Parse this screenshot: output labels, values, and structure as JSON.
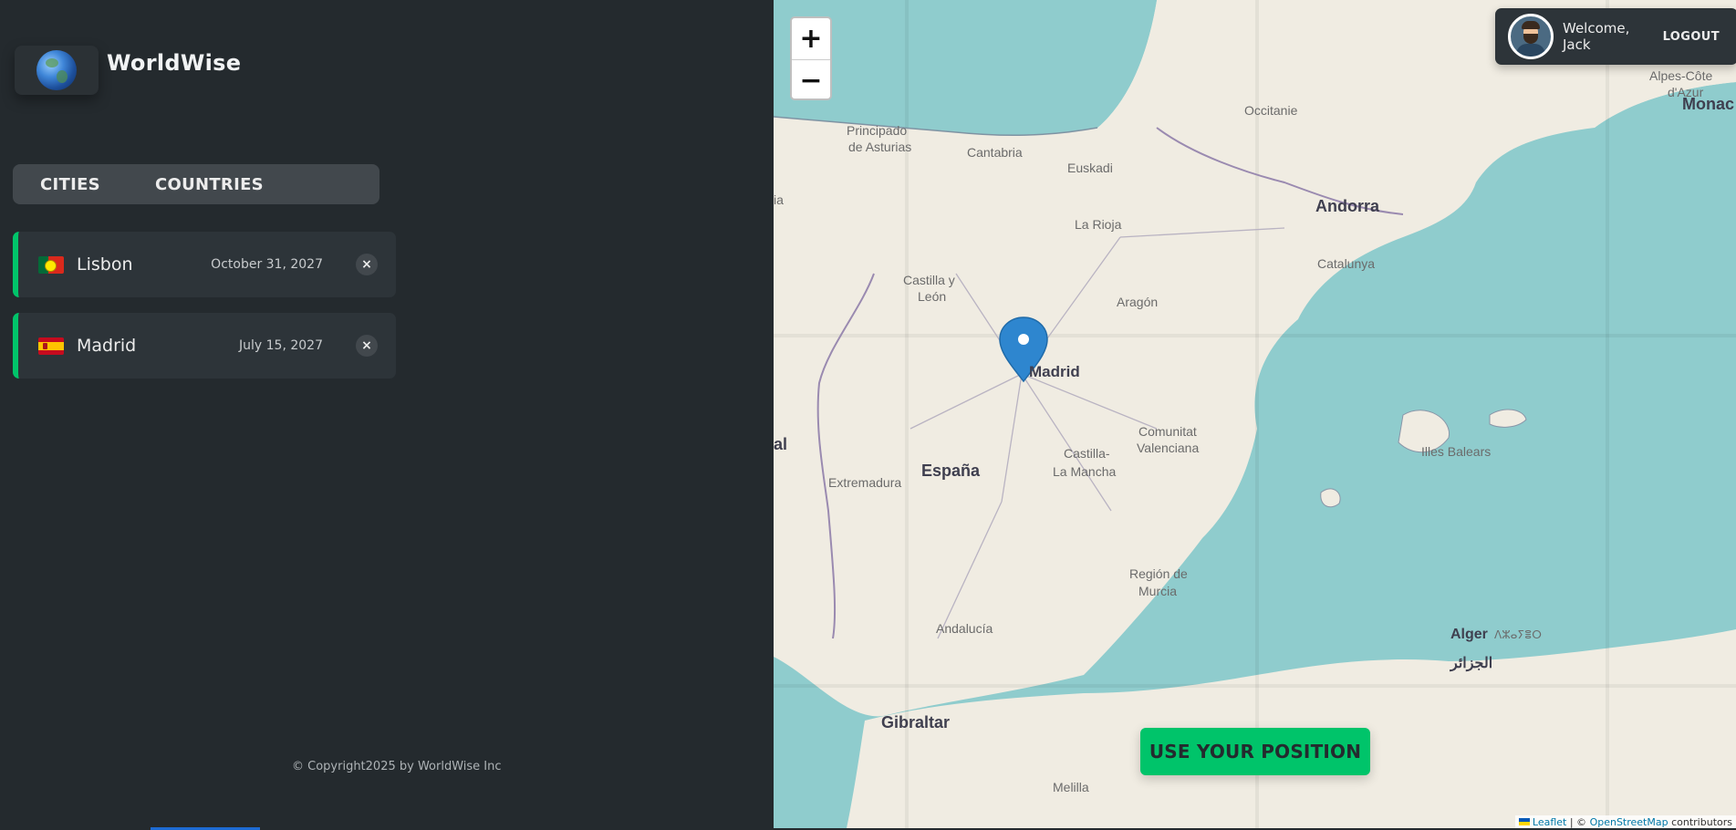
{
  "app": {
    "name": "WorldWise"
  },
  "tabs": [
    {
      "label": "CITIES"
    },
    {
      "label": "COUNTRIES"
    }
  ],
  "cities": [
    {
      "name": "Lisbon",
      "date": "October 31, 2027",
      "delete": "×",
      "flag": "portugal-flag-icon"
    },
    {
      "name": "Madrid",
      "date": "July 15, 2027",
      "delete": "×",
      "flag": "spain-flag-icon"
    }
  ],
  "footer": {
    "copyright": "© Copyright2025 by WorldWise Inc"
  },
  "user": {
    "welcome": "Welcome, Jack",
    "logout": "LOGOUT"
  },
  "map": {
    "zoom_in": "+",
    "zoom_out": "−",
    "position_button": "USE YOUR POSITION",
    "marker_city": "Madrid",
    "attribution": {
      "leaflet": "Leaflet",
      "sep": "| ©",
      "osm": "OpenStreetMap",
      "suffix": "contributors"
    },
    "labels": {
      "asturias1": "Principado",
      "asturias2": "de Asturias",
      "cantabria": "Cantabria",
      "euskadi": "Euskadi",
      "rioja": "La Rioja",
      "occitanie": "Occitanie",
      "andorra": "Andorra",
      "alpes1": "Alpes-Côte",
      "alpes2": "d'Azur",
      "monaco": "Monac",
      "catalunya": "Catalunya",
      "aragon": "Aragón",
      "castilla_leon1": "Castilla y",
      "castilla_leon2": "León",
      "madrid": "Madrid",
      "comunitat1": "Comunitat",
      "comunitat2": "Valenciana",
      "illes": "Illes Balears",
      "espana": "España",
      "extremadura": "Extremadura",
      "castilla_mancha1": "Castilla-",
      "castilla_mancha2": "La Mancha",
      "murcia1": "Región de",
      "murcia2": "Murcia",
      "andalucia": "Andalucía",
      "alger": "Alger",
      "alger_ar": "الجزائر",
      "alger_tf": "ⴷⵣⴰⵢⴻⵔ",
      "gibraltar": "Gibraltar",
      "melilla": "Melilla",
      "edge_ia": "ia",
      "edge_al": "al"
    },
    "colors": {
      "sea": "#8fcccd",
      "land": "#f0ece2",
      "accent": "#00c46a"
    }
  }
}
